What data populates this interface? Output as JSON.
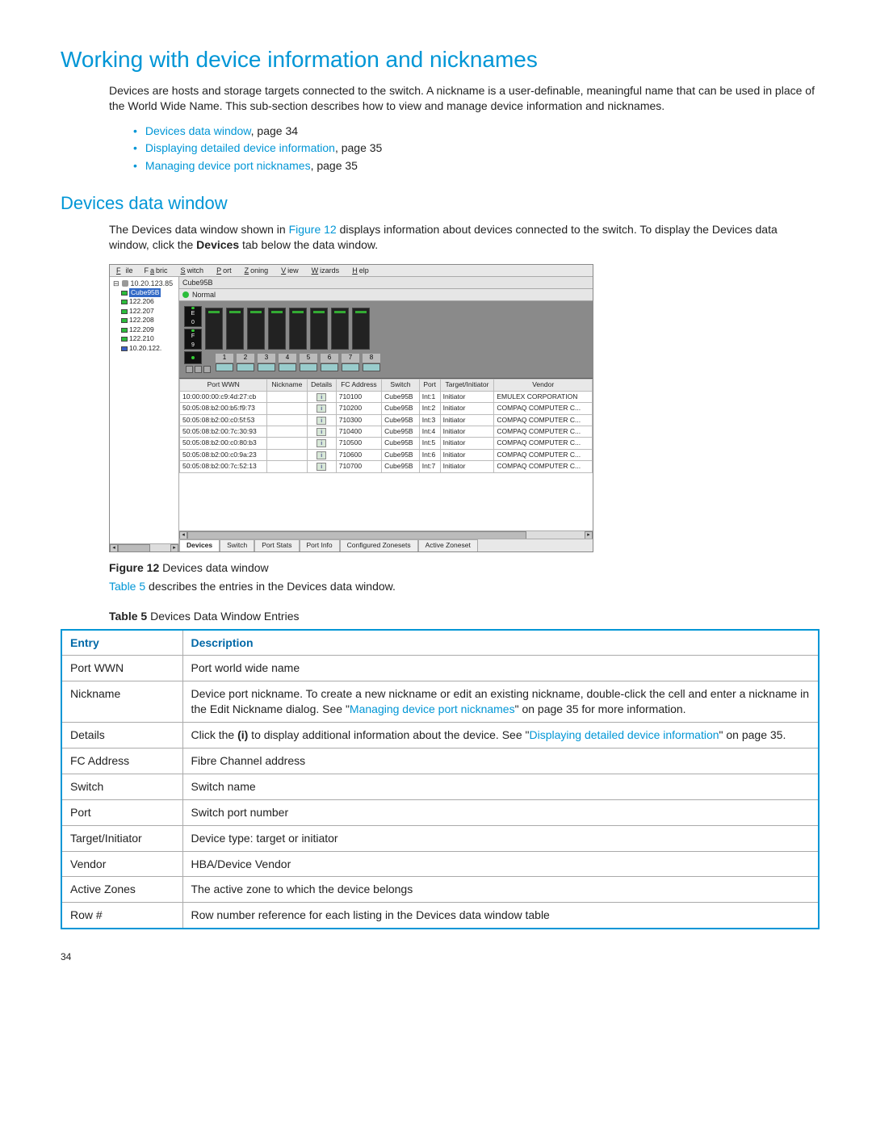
{
  "page_number": "34",
  "heading_main": "Working with device information and nicknames",
  "intro_para": "Devices are hosts and storage targets connected to the switch. A nickname is a user-definable, meaningful name that can be used in place of the World Wide Name. This sub-section describes how to view and manage device information and nicknames.",
  "bullet_links": [
    {
      "link": "Devices data window",
      "suffix": ", page 34"
    },
    {
      "link": "Displaying detailed device information",
      "suffix": ", page 35"
    },
    {
      "link": "Managing device port nicknames",
      "suffix": ", page 35"
    }
  ],
  "heading_sub": "Devices data window",
  "intro_para2_pre": "The Devices data window shown in ",
  "intro_para2_link": "Figure 12",
  "intro_para2_mid": " displays information about devices connected to the switch. To display the Devices data window, click the ",
  "intro_para2_bold": "Devices",
  "intro_para2_post": " tab below the data window.",
  "menubar": [
    "File",
    "Fabric",
    "Switch",
    "Port",
    "Zoning",
    "View",
    "Wizards",
    "Help"
  ],
  "tree": {
    "root": "10.20.123.85",
    "selected": "Cube95B",
    "items": [
      "122.206",
      "122.207",
      "122.208",
      "122.209",
      "122.210",
      "10.20.122."
    ]
  },
  "titlebar": "Cube95B",
  "status": "Normal",
  "port_numbers": [
    "1",
    "2",
    "3",
    "4",
    "5",
    "6",
    "7",
    "8"
  ],
  "port_labels_left": [
    "E",
    "0",
    "F",
    "9"
  ],
  "grid_headers": [
    "Port WWN",
    "Nickname",
    "Details",
    "FC Address",
    "Switch",
    "Port",
    "Target/Initiator",
    "Vendor"
  ],
  "grid_rows": [
    {
      "wwn": "10:00:00:00:c9:4d:27:cb",
      "nick": "",
      "fc": "710100",
      "sw": "Cube95B",
      "port": "Int:1",
      "ti": "Initiator",
      "vendor": "EMULEX CORPORATION"
    },
    {
      "wwn": "50:05:08:b2:00:b5:f9:73",
      "nick": "",
      "fc": "710200",
      "sw": "Cube95B",
      "port": "Int:2",
      "ti": "Initiator",
      "vendor": "COMPAQ COMPUTER C..."
    },
    {
      "wwn": "50:05:08:b2:00:c0:5f:53",
      "nick": "",
      "fc": "710300",
      "sw": "Cube95B",
      "port": "Int:3",
      "ti": "Initiator",
      "vendor": "COMPAQ COMPUTER C..."
    },
    {
      "wwn": "50:05:08:b2:00:7c:30:93",
      "nick": "",
      "fc": "710400",
      "sw": "Cube95B",
      "port": "Int:4",
      "ti": "Initiator",
      "vendor": "COMPAQ COMPUTER C..."
    },
    {
      "wwn": "50:05:08:b2:00:c0:80:b3",
      "nick": "",
      "fc": "710500",
      "sw": "Cube95B",
      "port": "Int:5",
      "ti": "Initiator",
      "vendor": "COMPAQ COMPUTER C..."
    },
    {
      "wwn": "50:05:08:b2:00:c0:9a:23",
      "nick": "",
      "fc": "710600",
      "sw": "Cube95B",
      "port": "Int:6",
      "ti": "Initiator",
      "vendor": "COMPAQ COMPUTER C..."
    },
    {
      "wwn": "50:05:08:b2:00:7c:52:13",
      "nick": "",
      "fc": "710700",
      "sw": "Cube95B",
      "port": "Int:7",
      "ti": "Initiator",
      "vendor": "COMPAQ COMPUTER C..."
    }
  ],
  "bottom_tabs": [
    "Devices",
    "Switch",
    "Port Stats",
    "Port Info",
    "Configured Zonesets",
    "Active Zoneset"
  ],
  "fig_caption_bold": "Figure 12",
  "fig_caption_rest": " Devices data window",
  "table5_pre_link": "Table 5",
  "table5_pre_rest": " describes the entries in the Devices data window.",
  "tbl_caption_bold": "Table 5",
  "tbl_caption_rest": " Devices Data Window Entries",
  "tbl_headers": {
    "c1": "Entry",
    "c2": "Description"
  },
  "tbl_rows": {
    "r0": {
      "e": "Port WWN",
      "d": "Port world wide name"
    },
    "r1": {
      "e": "Nickname",
      "d_pre": "Device port nickname. To create a new nickname or edit an existing nickname, double-click the cell and enter a nickname in the Edit Nickname dialog. See \"",
      "d_link": "Managing device port nicknames",
      "d_post": "\" on page 35 for more information."
    },
    "r2": {
      "e": "Details",
      "d_pre": "Click the ",
      "d_bold": "(i)",
      "d_mid": " to display additional information about the device. See \"",
      "d_link": "Displaying detailed device information",
      "d_post": "\" on page 35."
    },
    "r3": {
      "e": "FC Address",
      "d": "Fibre Channel address"
    },
    "r4": {
      "e": "Switch",
      "d": "Switch name"
    },
    "r5": {
      "e": "Port",
      "d": "Switch port number"
    },
    "r6": {
      "e": "Target/Initiator",
      "d": "Device type: target or initiator"
    },
    "r7": {
      "e": "Vendor",
      "d": "HBA/Device Vendor"
    },
    "r8": {
      "e": "Active Zones",
      "d": "The active zone to which the device belongs"
    },
    "r9": {
      "e": "Row #",
      "d": "Row number reference for each listing in the Devices data window table"
    }
  }
}
